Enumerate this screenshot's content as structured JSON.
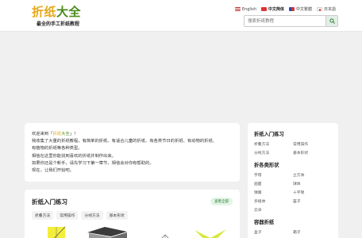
{
  "header": {
    "logo_part1": "折纸",
    "logo_part2": "大全",
    "slogan": "最全的手工折纸教程",
    "languages": [
      {
        "label": "English",
        "flag": "uk-flag-icon"
      },
      {
        "label": "中文简体",
        "flag": "china-flag-icon"
      },
      {
        "label": "中文繁體",
        "flag": "taiwan-flag-icon"
      },
      {
        "label": "日本語",
        "flag": "japan-flag-icon"
      }
    ],
    "search": {
      "placeholder": "搜索折纸教程",
      "icon": "search-icon"
    }
  },
  "intro": {
    "line1_prefix": "欢迎来到「",
    "line1_brand_a": "折纸",
    "line1_brand_b": "大全",
    "line1_suffix": "」！",
    "line2": "我收集了大量的折纸教程，有简单的折纸、有适合儿童的折纸、有各类节日的折纸、有动物的折纸、",
    "line3": "有植物的折纸等各种类型。",
    "line4": "相信在这里你能找到喜欢的折纸并制作出来。",
    "line5": "如果你还是个新手，请先学习下第一章节，相信会对你有帮助的。",
    "line6": "现在，让我们开始吧。"
  },
  "practice": {
    "title": "折纸入门练习",
    "view_all": "查看全部",
    "tags": [
      "折叠方法",
      "常用操作",
      "分线方法",
      "基本形状"
    ]
  },
  "sidebar": {
    "sections": [
      {
        "title": "折纸入门练习",
        "links": [
          "折叠方法",
          "常用操作",
          "分线方法",
          "基本形状"
        ]
      },
      {
        "title": "折各类形状",
        "links": [
          "字母",
          "立方体",
          "画面",
          "球体",
          "弹簧",
          "十字架",
          "多棱体",
          "笛子",
          "云朵"
        ]
      },
      {
        "title": "容器折纸",
        "links": [
          "盒子",
          "箱子"
        ]
      }
    ]
  },
  "colors": {
    "accent_green": "#4a8a1c",
    "accent_orange": "#e6a817",
    "page_bg": "#f0f0f0"
  }
}
